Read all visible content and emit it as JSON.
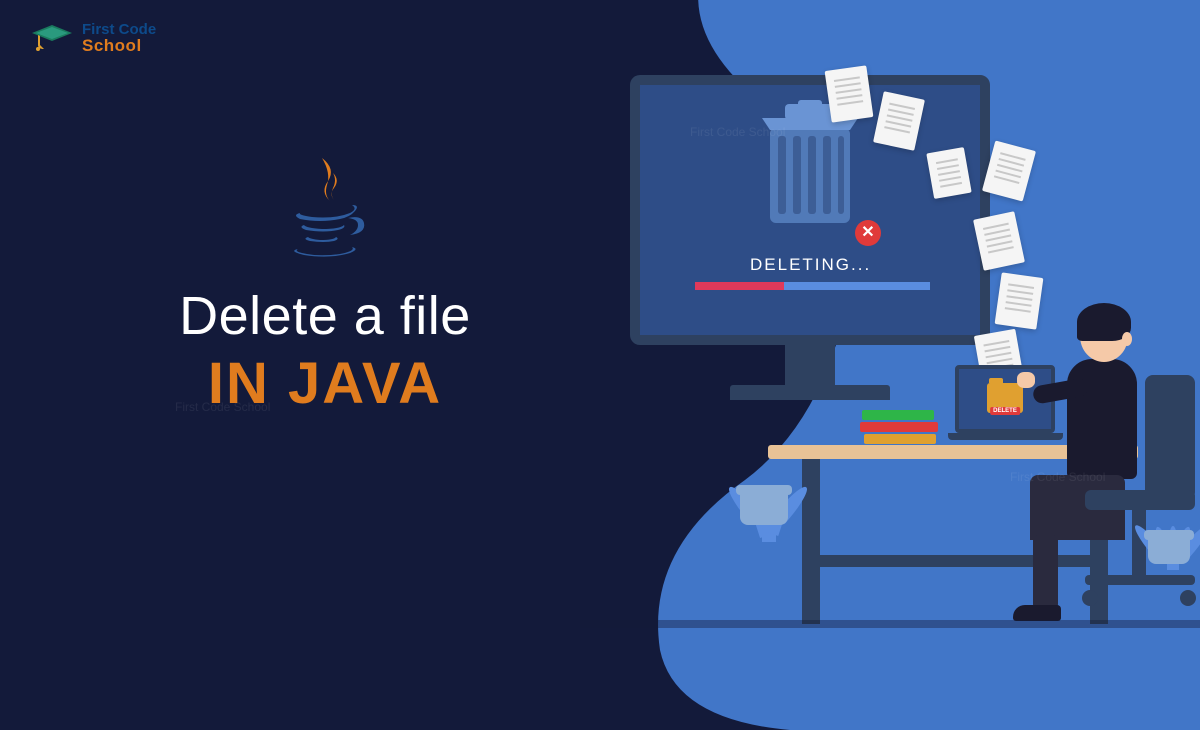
{
  "logo": {
    "line1": "First Code",
    "line2": "School"
  },
  "headline": {
    "line1": "Delete a file",
    "line2": "IN JAVA"
  },
  "screen": {
    "status_text": "DELETING...",
    "progress_percent": 38,
    "folder_label": "DELETE",
    "close_symbol": "✕"
  },
  "colors": {
    "background": "#131a3a",
    "accent_orange": "#e07c1e",
    "blob_blue": "#4176c8",
    "monitor_frame": "#2e4160",
    "monitor_screen": "#2e4d87",
    "progress_fill": "#e0395a",
    "progress_bg": "#5a8de0"
  },
  "watermark": "First Code School"
}
